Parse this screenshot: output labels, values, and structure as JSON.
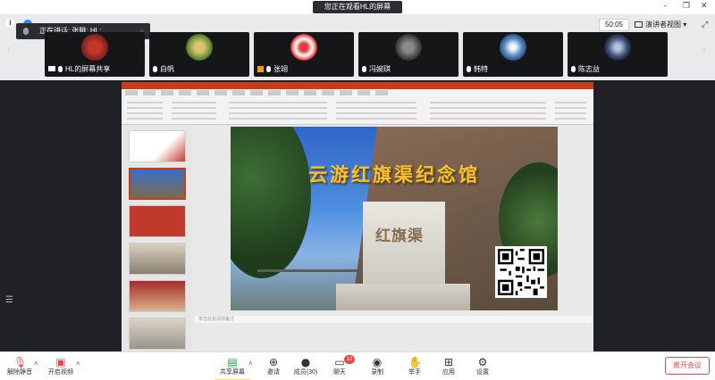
{
  "top_bar": {
    "sharing_status": "您正在观看HL的屏幕",
    "timer": "50:05",
    "presenter_view": "演讲者视图"
  },
  "speaking": {
    "text": "正在讲话: 张眺; HL;"
  },
  "participants": [
    {
      "name": "HL的屏幕共享",
      "status": "screen-share"
    },
    {
      "name": "白帆",
      "status": "mic"
    },
    {
      "name": "张翊",
      "status": "mic"
    },
    {
      "name": "冯婉琪",
      "status": "mic"
    },
    {
      "name": "韩特",
      "status": "mic"
    },
    {
      "name": "陈志益",
      "status": "mic"
    }
  ],
  "slide": {
    "headline": "云游红旗渠纪念馆",
    "monument_text": "红旗渠"
  },
  "ppt": {
    "notes_placeholder": "单击此处添加备注"
  },
  "toolbar": {
    "unmute": "解除静音",
    "start_video": "开启视频",
    "share_screen": "共享屏幕",
    "invite": "邀请",
    "members": "成员(30)",
    "chat": "聊天",
    "chat_badge": "12",
    "record": "录制",
    "raise_hand": "举手",
    "apps": "应用",
    "settings": "设置",
    "leave": "离开会议"
  }
}
